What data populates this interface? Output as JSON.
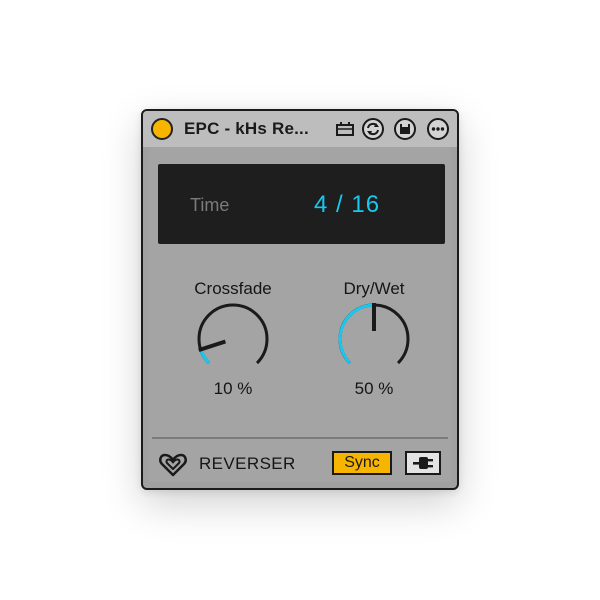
{
  "device": {
    "title": "EPC - kHs Re...",
    "power_on": true,
    "accent_color": "#f7b500",
    "value_color": "#17c8f0"
  },
  "titlebar_icons": [
    "midi-mapping-icon",
    "hot-swap-icon",
    "save-icon",
    "more-options-icon"
  ],
  "display": {
    "label": "Time",
    "value": "4 / 16"
  },
  "knobs": [
    {
      "label": "Crossfade",
      "value_text": "10 %",
      "value": 0.1
    },
    {
      "label": "Dry/Wet",
      "value_text": "50 %",
      "value": 0.5
    }
  ],
  "footer": {
    "brand_name": "REVERSER",
    "brand_icon": "heart-logo-icon",
    "sync_label": "Sync",
    "sync_active": true,
    "plug_icon": "plug-icon"
  }
}
